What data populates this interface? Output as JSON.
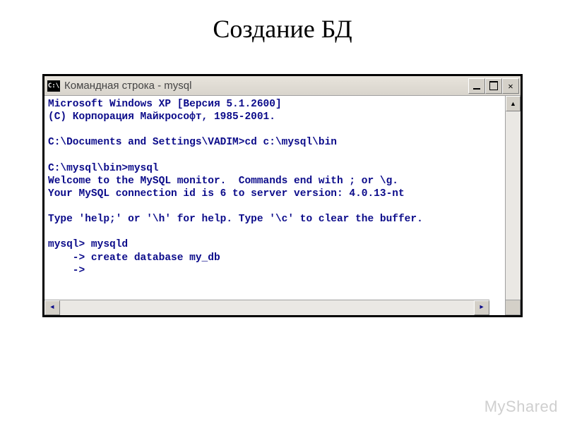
{
  "page": {
    "title": "Создание БД"
  },
  "window": {
    "icon_label": "C:\\",
    "title": "Командная строка - mysql"
  },
  "console": {
    "lines": [
      "Microsoft Windows XP [Версия 5.1.2600]",
      "(C) Корпорация Майкрософт, 1985-2001.",
      "",
      "C:\\Documents and Settings\\VADIM>cd c:\\mysql\\bin",
      "",
      "C:\\mysql\\bin>mysql",
      "Welcome to the MySQL monitor.  Commands end with ; or \\g.",
      "Your MySQL connection id is 6 to server version: 4.0.13-nt",
      "",
      "Type 'help;' or '\\h' for help. Type '\\c' to clear the buffer.",
      "",
      "mysql> mysqld",
      "    -> create database my_db",
      "    ->"
    ]
  },
  "watermark": "MyShared"
}
